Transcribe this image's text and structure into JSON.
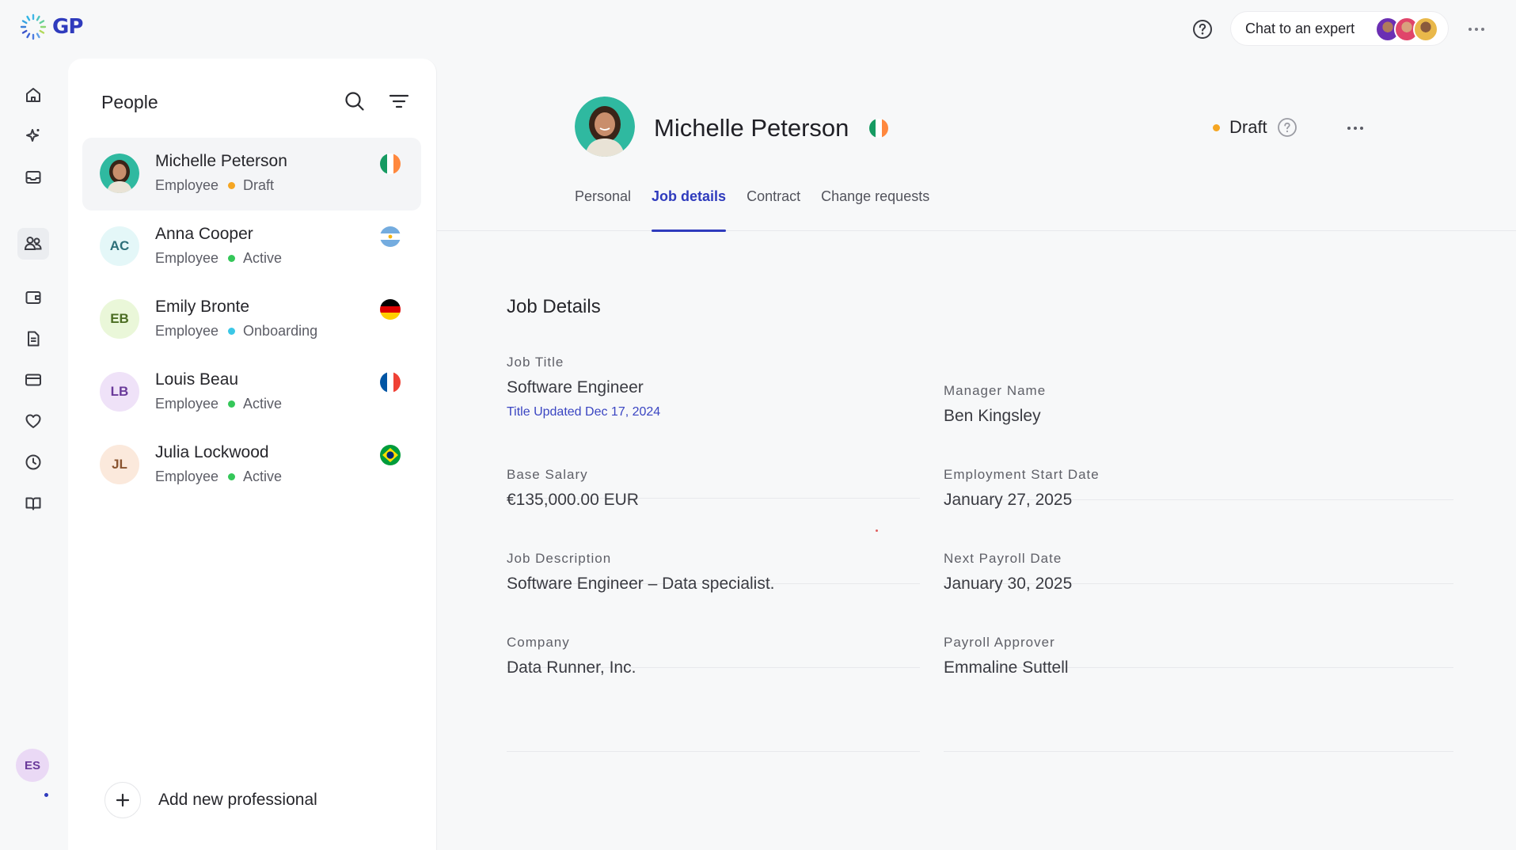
{
  "app": {
    "logo_text": "GP",
    "chat_label": "Chat to an expert",
    "accent_color": "#2f3bbd"
  },
  "rail": {
    "icons": [
      "home-icon",
      "sparkle-icon",
      "inbox-icon",
      "people-icon",
      "wallet-icon",
      "document-icon",
      "card-icon",
      "heart-icon",
      "clock-icon",
      "book-icon"
    ],
    "active": "people-icon",
    "user_initials": "ES"
  },
  "people": {
    "title": "People",
    "items": [
      {
        "name": "Michelle Peterson",
        "role": "Employee",
        "status": "Draft",
        "status_color": "#f5a623",
        "initials": "",
        "flag": "ireland",
        "selected": true
      },
      {
        "name": "Anna Cooper",
        "role": "Employee",
        "status": "Active",
        "status_color": "#34c759",
        "initials": "AC",
        "flag": "argentina"
      },
      {
        "name": "Emily Bronte",
        "role": "Employee",
        "status": "Onboarding",
        "status_color": "#3bc7e6",
        "initials": "EB",
        "flag": "germany"
      },
      {
        "name": "Louis Beau",
        "role": "Employee",
        "status": "Active",
        "status_color": "#34c759",
        "initials": "LB",
        "flag": "france"
      },
      {
        "name": "Julia Lockwood",
        "role": "Employee",
        "status": "Active",
        "status_color": "#34c759",
        "initials": "JL",
        "flag": "brazil"
      }
    ],
    "add_label": "Add new professional"
  },
  "profile": {
    "name": "Michelle Peterson",
    "status": "Draft",
    "status_color": "#f5a623",
    "tabs": [
      "Personal",
      "Job details",
      "Contract",
      "Change requests"
    ],
    "active_tab": "Job details"
  },
  "job_details": {
    "title": "Job Details",
    "job_title_label": "Job Title",
    "job_title_value": "Software Engineer",
    "job_title_note": "Title Updated Dec 17, 2024",
    "manager_label": "Manager Name",
    "manager_value": "Ben Kingsley",
    "salary_label": "Base Salary",
    "salary_value": "€135,000.00 EUR",
    "start_label": "Employment Start Date",
    "start_value": "January 27, 2025",
    "description_label": "Job Description",
    "description_value": "Software Engineer – Data specialist.",
    "payroll_label": "Next Payroll Date",
    "payroll_value": "January 30, 2025",
    "company_label": "Company",
    "company_value": "Data Runner, Inc.",
    "approver_label": "Payroll Approver",
    "approver_value": "Emmaline Suttell"
  }
}
